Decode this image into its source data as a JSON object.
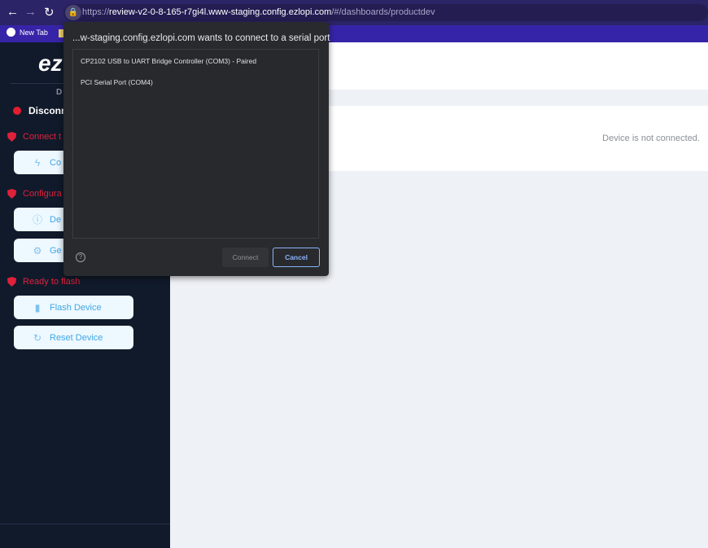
{
  "browser": {
    "url_scheme": "https://",
    "url_host": "review-v2-0-8-165-r7gi4l.www-staging.config.ezlopi.com",
    "url_path": "/#/dashboards/productdev",
    "bookmark_new_tab": "New Tab"
  },
  "sidebar": {
    "logo": "ez",
    "device_label": "D",
    "status": "Disconne",
    "sections": [
      {
        "label": "Connect t",
        "buttons": [
          {
            "label": "Co",
            "icon": "bolt-icon"
          }
        ]
      },
      {
        "label": "Configura",
        "buttons": [
          {
            "label": "De",
            "icon": "info-icon"
          },
          {
            "label": "Ge",
            "icon": "gear-icon"
          }
        ]
      },
      {
        "label": "Ready to flash",
        "buttons": [
          {
            "label": "Flash Device",
            "icon": "flash-device-icon"
          },
          {
            "label": "Reset Device",
            "icon": "reset-icon"
          }
        ]
      }
    ]
  },
  "main": {
    "device_message": "Device is not connected."
  },
  "dialog": {
    "title": "...w-staging.config.ezlopi.com wants to connect to a serial port",
    "ports": [
      "CP2102 USB to UART Bridge Controller (COM3) - Paired",
      "PCI Serial Port (COM4)"
    ],
    "help": "?",
    "connect_label": "Connect",
    "cancel_label": "Cancel"
  },
  "colors": {
    "sidebar_bg": "#111a2b",
    "alert_red": "#e0213c",
    "button_text": "#3fa7e6",
    "brand_purple": "#3624a8"
  }
}
